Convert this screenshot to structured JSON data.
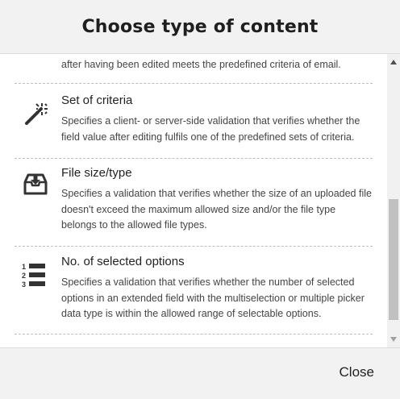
{
  "dialog": {
    "title": "Choose type of content",
    "partial_text": "after having been edited meets the predefined criteria of email.",
    "items": [
      {
        "icon": "magic-wand-icon",
        "title": "Set of criteria",
        "description": "Specifies a client- or server-side validation that verifies whether the field value after editing fulfils one of the predefined sets of criteria."
      },
      {
        "icon": "inbox-download-icon",
        "title": "File size/type",
        "description": "Specifies a validation that verifies whether the size of an uploaded file doesn't exceed the maximum allowed size and/or the file type belongs to the allowed file types."
      },
      {
        "icon": "numbered-list-icon",
        "title": "No. of selected options",
        "description": "Specifies a validation that verifies whether the number of selected options in an extended field with the multiselection or multiple picker data type is within the allowed range of selectable options."
      }
    ],
    "close_label": "Close"
  },
  "colors": {
    "header_bg": "#f2f2f2",
    "separator": "#bdbdbd",
    "scroll_thumb": "#c1c1c1",
    "icon": "#333333"
  }
}
